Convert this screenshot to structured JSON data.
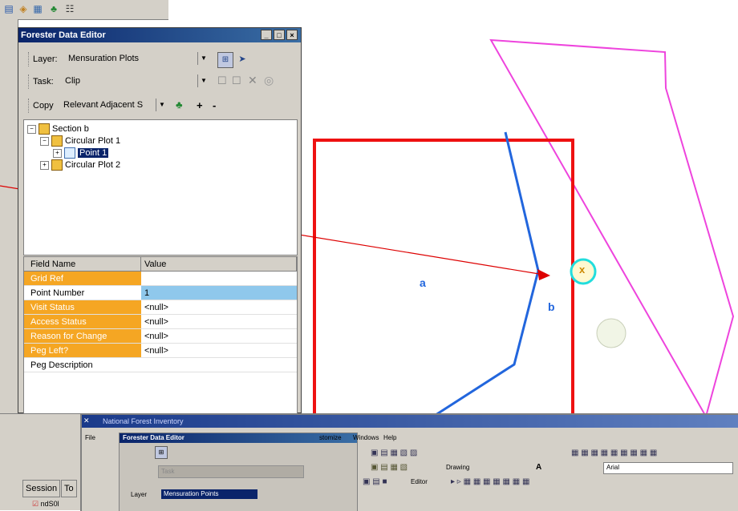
{
  "editor": {
    "title": "Forester Data Editor",
    "layer_label": "Layer:",
    "layer_value": "Mensuration Plots",
    "task_label": "Task:",
    "task_value": "Clip",
    "copy_label": "Copy",
    "copy_value": "Relevant Adjacent S",
    "add_symbol": "+",
    "remove_symbol": "-",
    "tree": [
      {
        "label": "Section b"
      },
      {
        "label": "Circular Plot 1"
      },
      {
        "label": "Point 1"
      },
      {
        "label": "Circular Plot 2"
      }
    ],
    "grid_headers": [
      "Field Name",
      "Value"
    ],
    "grid_rows": [
      {
        "name": "Grid Ref",
        "value": ""
      },
      {
        "name": "Point Number",
        "value": "1"
      },
      {
        "name": "Visit Status",
        "value": "<null>"
      },
      {
        "name": "Access Status",
        "value": "<null>"
      },
      {
        "name": "Reason for Change",
        "value": "<null>"
      },
      {
        "name": "Peg Left?",
        "value": "<null>"
      },
      {
        "name": "Peg Description",
        "value": ""
      }
    ]
  },
  "lower": {
    "tab_session": "Session",
    "tab_to": "To",
    "item": "ndS0l"
  },
  "map": {
    "label_a": "a",
    "label_b": "b",
    "marker": "x",
    "colors": {
      "red": "#ee1111",
      "blue": "#2266dd",
      "magenta": "#ee44dd",
      "cyan": "#22dddd",
      "arrow": "#dd0000"
    }
  },
  "inset": {
    "title": "Forester Data Editor",
    "file_menu": "File",
    "window_title_frag": "National Forest Inventory",
    "menu_windows": "Windows",
    "menu_help": "Help",
    "menu_customize": "stomize",
    "layer_label": "Layer",
    "layer_value": "Mensuration Points",
    "drawing": "Drawing",
    "editor": "Editor",
    "font": "Arial",
    "task_label": "Task"
  }
}
